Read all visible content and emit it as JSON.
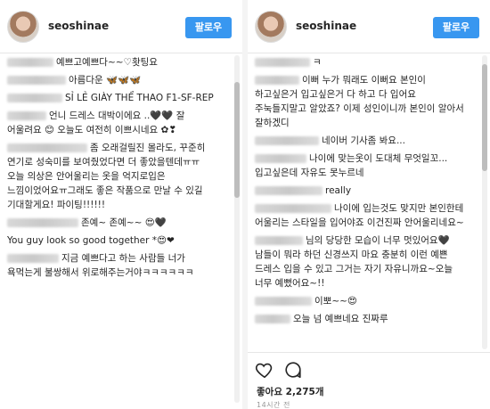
{
  "left": {
    "username": "seoshinae",
    "follow_label": "팔로우",
    "comments": [
      {
        "blur": 52,
        "text": "예쁘고예쁘다~~♡홧팅요"
      },
      {
        "blur": 66,
        "text": "아름다운 🦋🦋🦋"
      },
      {
        "blur": 62,
        "text": "SỈ LẺ GIÀY THỂ THAO F1-SF-REP"
      },
      {
        "blur": 44,
        "text": "언니 드레스 대박이에요 ..🖤🖤 잘 어울려요 😊 오늘도 여전히 이쁘시네요 ✿❣"
      },
      {
        "blur": 90,
        "text": "좀 오래걸릴진 몰라도, 꾸준히 연기로 성숙미를 보여줬었다면 더 좋았을텐데ㅠㅠ 오늘 의상은 안어울리는 옷을 억지로입은 느낌이었어요ㅠ그래도 좋은 작품으로 만날 수 있길 기대할게요! 파이팅!!!!!!"
      },
      {
        "blur": 80,
        "text": "존예~ 존예~~ 😍🖤"
      },
      {
        "blur": 0,
        "text": "You guy look so good together *😍❤"
      },
      {
        "blur": 58,
        "text": "지금 예쁘다고 하는 사람들 너가 욕먹는게 불쌍해서 위로해주는거야ㅋㅋㅋㅋㅋㅋ"
      }
    ]
  },
  "right": {
    "username": "seoshinae",
    "follow_label": "팔로우",
    "comments": [
      {
        "blur": 62,
        "text": "ㅋ"
      },
      {
        "blur": 50,
        "text": "이뻐 누가 뭐래도 이뻐요 본인이 하고싶은거 입고싶은거 다 하고 다 입어요 주눅들지말고 알았죠? 이제 성인이니까 본인이 알아서 잘하겠디"
      },
      {
        "blur": 72,
        "text": "네이버 기사좀 봐요..."
      },
      {
        "blur": 58,
        "text": "나이에 맞는옷이 도대체 무엇일꼬...입고싶은데 자유도 못누르네"
      },
      {
        "blur": 76,
        "text": "really"
      },
      {
        "blur": 86,
        "text": "나이에 입는것도 맞지만 본인한테 어울리는 스타일을 입어야죠 이건진짜 안어울리네요~"
      },
      {
        "blur": 54,
        "text": "님의 당당한 모습이 너무 멋있어요🖤남들이 뭐라 하던 신경쓰지 마요 충분히 이런 예쁜 드레스 입을 수 있고 그거는 자기 자유니까요~오늘 너무 예뻤어요~!!"
      },
      {
        "blur": 64,
        "text": "이뽀~~😍"
      },
      {
        "blur": 40,
        "text": "오늘 넘 예쁘네요 진짜루"
      }
    ],
    "likes_text": "좋아요 2,275개",
    "timestamp": "14시간 전"
  },
  "colors": {
    "accent": "#3897f0",
    "text": "#262626",
    "muted": "#999999"
  },
  "icons": [
    "heart-icon",
    "comment-icon"
  ]
}
